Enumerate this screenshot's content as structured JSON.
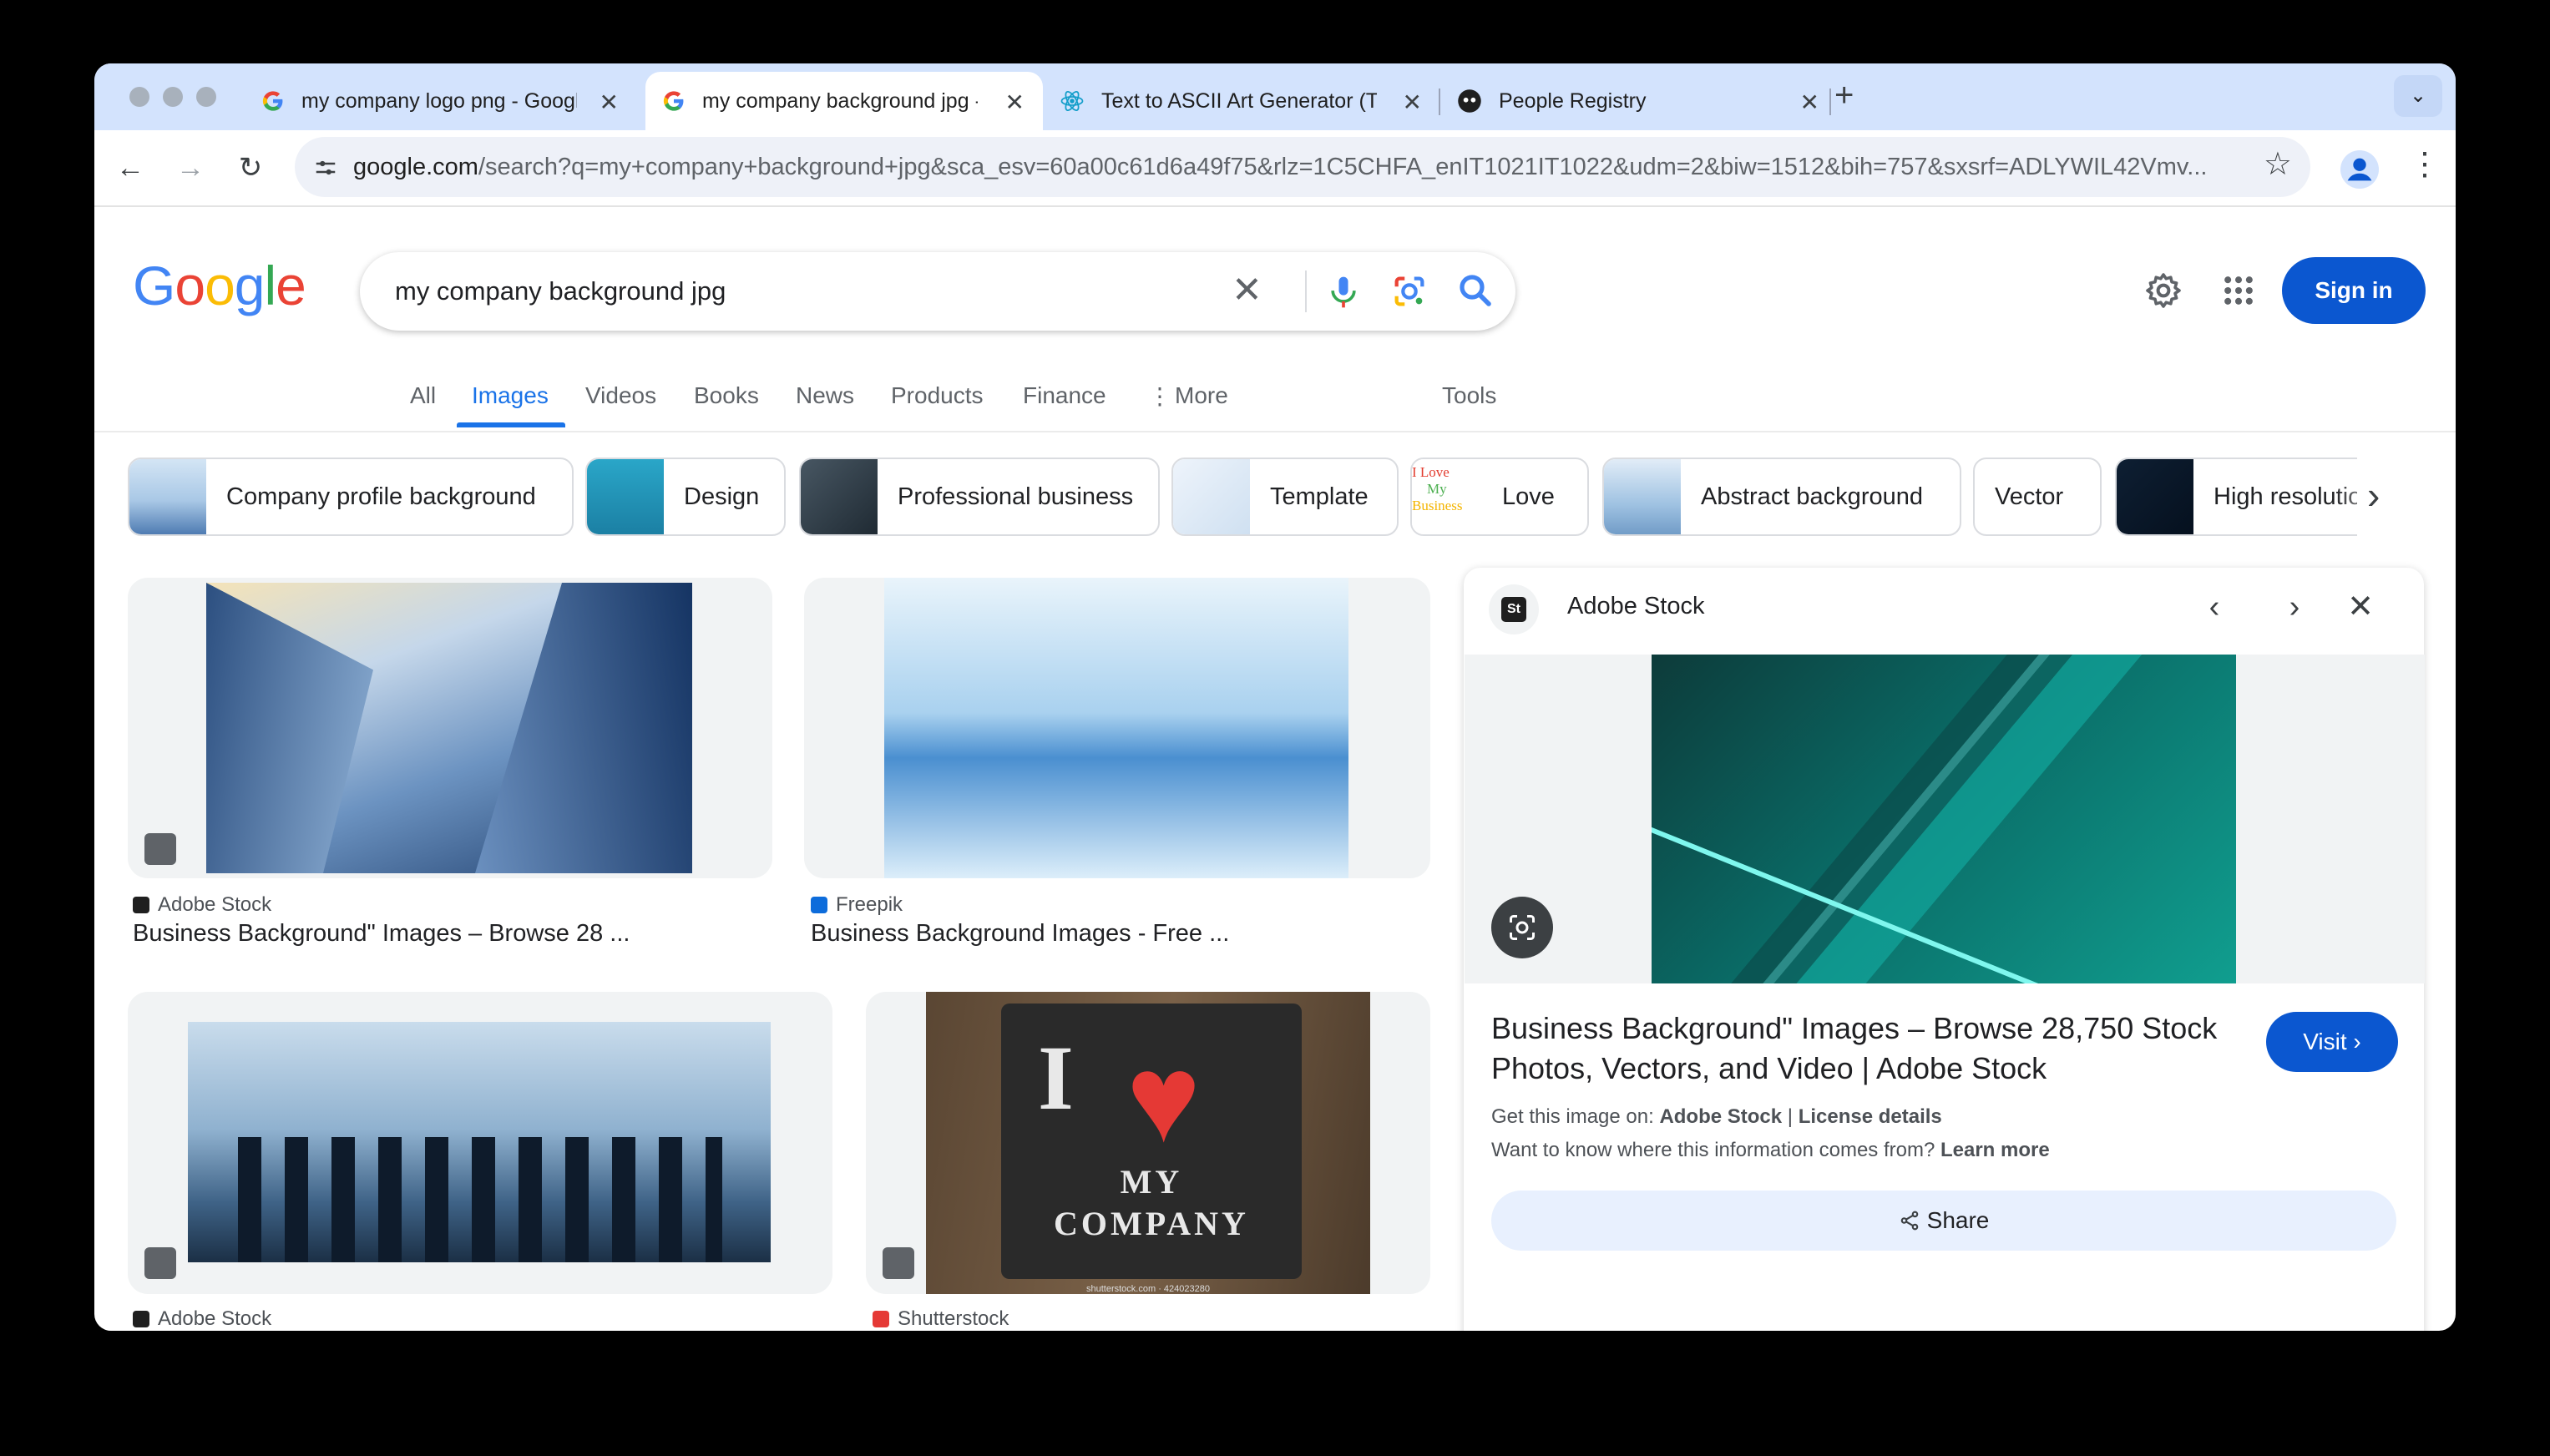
{
  "browser": {
    "tabs": [
      {
        "title": "my company logo png - Google Search",
        "favicon": "google-icon"
      },
      {
        "title": "my company background jpg - Google Search",
        "favicon": "google-icon",
        "active": true
      },
      {
        "title": "Text to ASCII Art Generator (TAAG)",
        "favicon": "react-icon"
      },
      {
        "title": "People Registry",
        "favicon": "github-icon"
      }
    ],
    "url_host": "google.com",
    "url_path": "/search?q=my+company+background+jpg&sca_esv=60a00c61d6a49f75&rlz=1C5CHFA_enIT1021IT1022&udm=2&biw=1512&bih=757&sxsrf=ADLYWIL42Vmv..."
  },
  "google": {
    "logo": "Google",
    "query": "my company background jpg",
    "sign_in": "Sign in",
    "nav": [
      "All",
      "Images",
      "Videos",
      "Books",
      "News",
      "Products",
      "Finance",
      "More",
      "Tools"
    ],
    "active_nav": "Images"
  },
  "chips": [
    "Company profile background",
    "Design",
    "Professional business",
    "Template",
    "Love",
    "Abstract background",
    "Vector",
    "High resolution"
  ],
  "chip_love_thumb": [
    "I Love",
    "My",
    "Business"
  ],
  "results": [
    {
      "source": "Adobe Stock",
      "title": "Business Background\" Images – Browse 28 ..."
    },
    {
      "source": "Freepik",
      "title": "Business Background Images - Free ..."
    },
    {
      "source": "Adobe Stock",
      "title": ""
    },
    {
      "source": "Shutterstock",
      "title": "",
      "image_text": [
        "I",
        "MY",
        "COMPANY"
      ],
      "watermark": "shutterstock.com · 424023280"
    }
  ],
  "panel": {
    "source": "Adobe Stock",
    "source_logo": "St",
    "title": "Business Background\" Images – Browse 28,750 Stock Photos, Vectors, and Video | Adobe Stock",
    "visit": "Visit",
    "get_prefix": "Get this image on: ",
    "get_source": "Adobe Stock",
    "sep": " | ",
    "license": "License details",
    "info_q": "Want to know where this information comes from? ",
    "learn_more": "Learn more",
    "share": "Share"
  }
}
